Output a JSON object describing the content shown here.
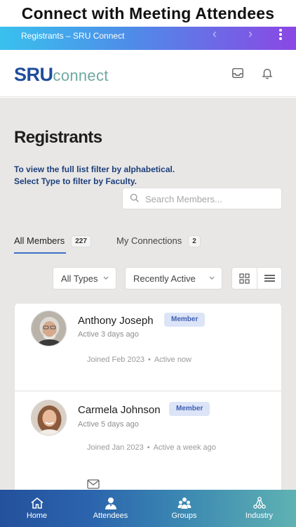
{
  "banner": {
    "title": "Connect with Meeting Attendees"
  },
  "browser": {
    "tab_title": "Registrants – SRU Connect"
  },
  "header": {
    "logo_sru": "SRU",
    "logo_connect": "connect"
  },
  "page": {
    "title": "Registrants",
    "info_line1": "To view the full list filter by alphabetical.",
    "info_line2": "Select Type to filter by Faculty."
  },
  "search": {
    "placeholder": "Search Members..."
  },
  "tabs": [
    {
      "label": "All Members",
      "count": "227"
    },
    {
      "label": "My Connections",
      "count": "2"
    }
  ],
  "filters": {
    "type_value": "All Types",
    "sort_value": "Recently Active"
  },
  "members": [
    {
      "name": "Anthony Joseph",
      "badge": "Member",
      "active": "Active 3 days ago",
      "joined": "Joined Feb 2023",
      "status": "Active now"
    },
    {
      "name": "Carmela Johnson",
      "badge": "Member",
      "active": "Active 5 days ago",
      "joined": "Joined Jan 2023",
      "status": "Active a week ago"
    }
  ],
  "bottom_nav": [
    {
      "label": "Home",
      "icon": "home-icon"
    },
    {
      "label": "Attendees",
      "icon": "attendee-icon"
    },
    {
      "label": "Groups",
      "icon": "groups-icon"
    },
    {
      "label": "Industry",
      "icon": "industry-icon"
    }
  ],
  "colors": {
    "brand_blue": "#1f4e9a",
    "brand_teal": "#6fa9a0",
    "badge_bg": "#dce4f7",
    "badge_text": "#3e5fb1",
    "tab_underline": "#3d72c2"
  }
}
